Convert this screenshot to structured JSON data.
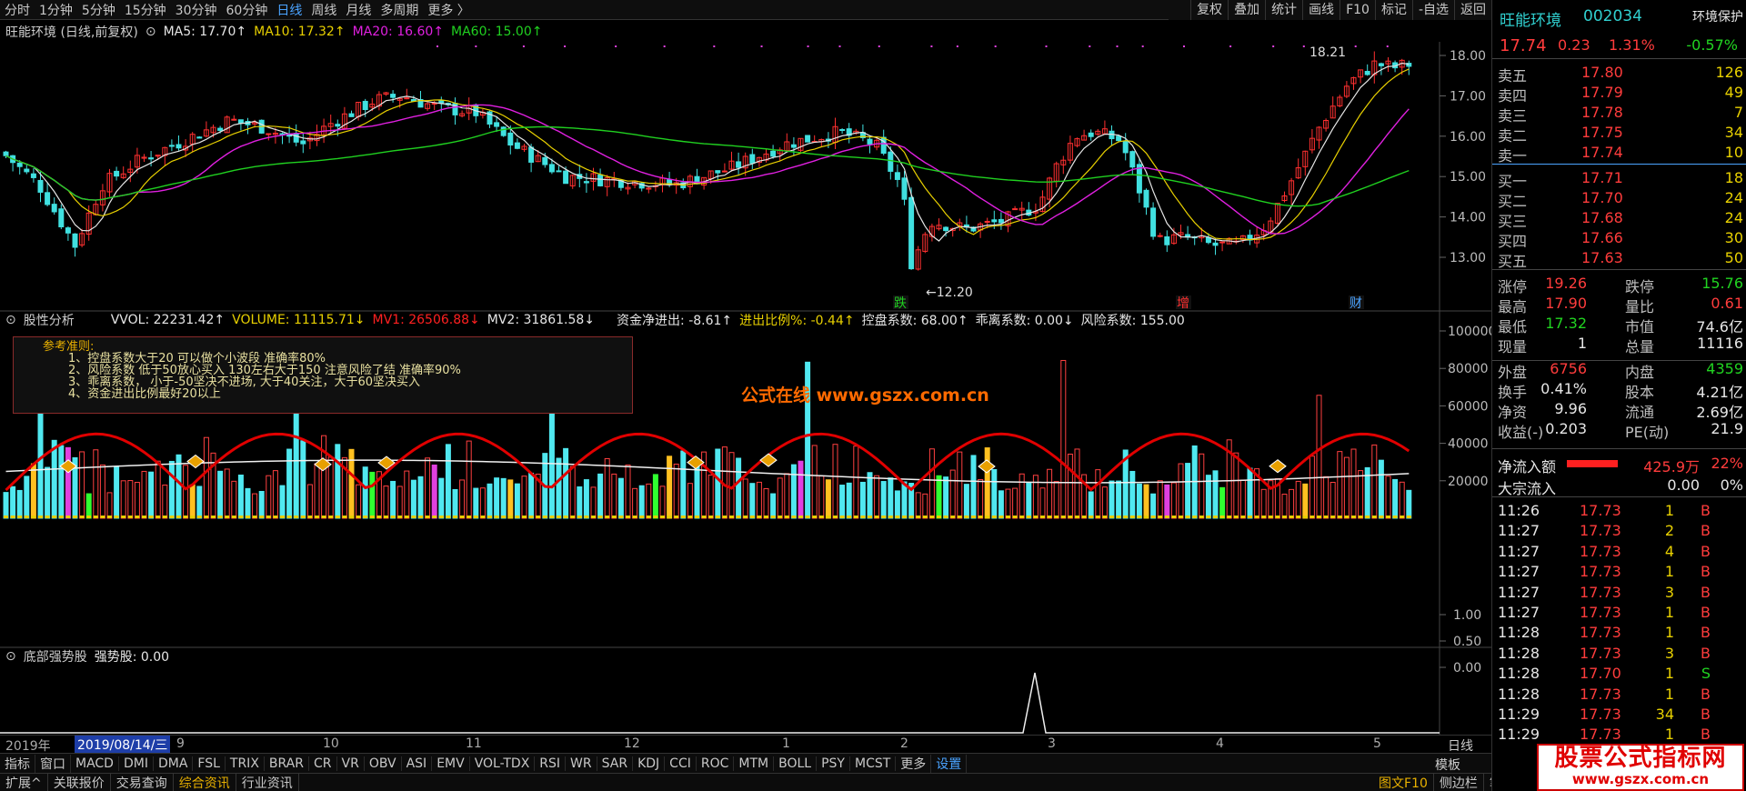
{
  "menu": {
    "items": [
      "分时",
      "1分钟",
      "5分钟",
      "15分钟",
      "30分钟",
      "60分钟",
      "日线",
      "周线",
      "月线",
      "多周期",
      "更多 〉"
    ],
    "active_index": 6
  },
  "toolbar": [
    "复权",
    "叠加",
    "统计",
    "画线",
    "F10",
    "标记",
    "-自选",
    "返回"
  ],
  "ma_header": {
    "stock": "旺能环境 (日线,前复权)",
    "ma5": "MA5: 17.70↑",
    "ma10": "MA10: 17.32↑",
    "ma20": "MA20: 16.60↑",
    "ma60": "MA60: 15.00↑"
  },
  "price_axis": [
    "18.00",
    "17.00",
    "16.00",
    "15.00",
    "14.00",
    "13.00"
  ],
  "annotations": {
    "high": "18.21",
    "low": "12.20",
    "marker1": "跌",
    "marker2": "增",
    "marker3": "财"
  },
  "panel2": {
    "title": "股性分析",
    "vvol": "VVOL: 22231.42↑",
    "volume": "VOLUME: 11115.71↓",
    "mv1": "MV1: 26506.88↓",
    "mv2": "MV2: 31861.58↓",
    "fund": "资金净进出: -8.61↑",
    "ratio": "进出比例%: -0.44↑",
    "control": "控盘系数: 68.00↑",
    "deviation": "乖离系数: 0.00↓",
    "risk": "风险系数: 155.00"
  },
  "vol_axis": [
    "100000",
    "80000",
    "60000",
    "40000",
    "20000"
  ],
  "ref_box": {
    "title": "参考准则:",
    "rules": [
      "1、控盘系数大于20 可以做个小波段  准确率80%",
      "2、风险系数 低于50放心买入 130左右大于150 注意风险了结  准确率90%",
      "3、乖离系数，  小于-50坚决不进场, 大于40关注，大于60坚决买入",
      "4、资金进出比例最好20以上"
    ]
  },
  "watermark": "公式在线  www.gszx.com.cn",
  "panel3": {
    "title": "底部强势股",
    "value": "强势股: 0.00"
  },
  "p3_axis": [
    "1.00",
    "0.50",
    "0.00"
  ],
  "dates": {
    "year": "2019年",
    "selected": "2019/08/14/三",
    "months": [
      "9",
      "10",
      "11",
      "12",
      "1",
      "2",
      "3",
      "4",
      "5"
    ],
    "period": "日线"
  },
  "tabs": [
    "指标",
    "窗口",
    "MACD",
    "DMI",
    "DMA",
    "FSL",
    "TRIX",
    "BRAR",
    "CR",
    "VR",
    "OBV",
    "ASI",
    "EMV",
    "VOL-TDX",
    "RSI",
    "WR",
    "SAR",
    "KDJ",
    "CCI",
    "ROC",
    "MTM",
    "BOLL",
    "PSY",
    "MCST",
    "更多",
    "设置"
  ],
  "tabs_active": "设置",
  "tabs_right": "模板",
  "status": [
    "扩展^",
    "关联报价",
    "交易查询",
    "综合资讯",
    "行业资讯"
  ],
  "status_active": "综合资讯",
  "status_right": [
    "图文F10",
    "侧边栏",
    "笔"
  ],
  "quote": {
    "name": "旺能环境",
    "code": "002034",
    "tag": "环境保护",
    "price": "17.74",
    "change": "0.23",
    "pct": "1.31%",
    "sector_pct": "-0.57%",
    "sell": [
      [
        "卖五",
        "17.80",
        "126"
      ],
      [
        "卖四",
        "17.79",
        "49"
      ],
      [
        "卖三",
        "17.78",
        "7"
      ],
      [
        "卖二",
        "17.75",
        "34"
      ],
      [
        "卖一",
        "17.74",
        "10"
      ]
    ],
    "buy": [
      [
        "买一",
        "17.71",
        "18"
      ],
      [
        "买二",
        "17.70",
        "24"
      ],
      [
        "买三",
        "17.68",
        "24"
      ],
      [
        "买四",
        "17.66",
        "30"
      ],
      [
        "买五",
        "17.63",
        "50"
      ]
    ],
    "stats": [
      [
        "涨停",
        "19.26",
        "跌停",
        "15.76"
      ],
      [
        "最高",
        "17.90",
        "量比",
        "0.61"
      ],
      [
        "最低",
        "17.32",
        "市值",
        "74.6亿"
      ],
      [
        "现量",
        "1",
        "总量",
        "11116"
      ],
      [
        "外盘",
        "6756",
        "内盘",
        "4359"
      ],
      [
        "换手",
        "0.41%",
        "股本",
        "4.21亿"
      ],
      [
        "净资",
        "9.96",
        "流通",
        "2.69亿"
      ],
      [
        "收益(-)",
        "0.203",
        "PE(动)",
        "21.9"
      ]
    ],
    "netflow_label": "净流入额",
    "netflow": "425.9万",
    "netflow_pct": "22%",
    "block_label": "大宗流入",
    "block": "0.00",
    "block_pct": "0%",
    "ticks": [
      [
        "11:26",
        "17.73",
        "1",
        "B"
      ],
      [
        "11:27",
        "17.73",
        "2",
        "B"
      ],
      [
        "11:27",
        "17.73",
        "4",
        "B"
      ],
      [
        "11:27",
        "17.73",
        "1",
        "B"
      ],
      [
        "11:27",
        "17.73",
        "3",
        "B"
      ],
      [
        "11:27",
        "17.73",
        "1",
        "B"
      ],
      [
        "11:28",
        "17.73",
        "1",
        "B"
      ],
      [
        "11:28",
        "17.73",
        "3",
        "B"
      ],
      [
        "11:28",
        "17.70",
        "1",
        "S"
      ],
      [
        "11:28",
        "17.73",
        "1",
        "B"
      ],
      [
        "11:29",
        "17.73",
        "34",
        "B"
      ],
      [
        "11:29",
        "17.73",
        "1",
        "B"
      ]
    ]
  },
  "logo": {
    "line1": "股票公式指标网",
    "line2": "www.gszx.com.cn"
  }
}
